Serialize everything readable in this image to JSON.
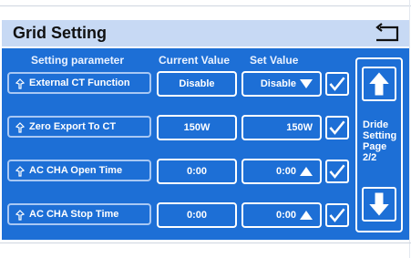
{
  "title": "Grid Setting",
  "icons": {
    "back": "back-arrow-icon",
    "pin": "pin-icon",
    "dropdown": "triangle-down-icon",
    "up": "triangle-up-icon",
    "check": "check-icon",
    "page_up": "arrow-up-icon",
    "page_down": "arrow-down-icon"
  },
  "headers": {
    "param": "Setting parameter",
    "current": "Current Value",
    "set": "Set Value"
  },
  "rows": [
    {
      "label": "External CT Function",
      "current": "Disable",
      "set": "Disable",
      "control": "dropdown"
    },
    {
      "label": "Zero Export  To CT",
      "current": "150W",
      "set": "150W",
      "control": "none"
    },
    {
      "label": "AC CHA Open Time",
      "current": "0:00",
      "set": "0:00",
      "control": "up"
    },
    {
      "label": "AC CHA Stop Time",
      "current": "0:00",
      "set": "0:00",
      "control": "up"
    }
  ],
  "side_label": "Dride\nSetting\nPage\n2/2",
  "colors": {
    "panel": "#1d6fd6",
    "titlebar": "#c7d9f4"
  }
}
